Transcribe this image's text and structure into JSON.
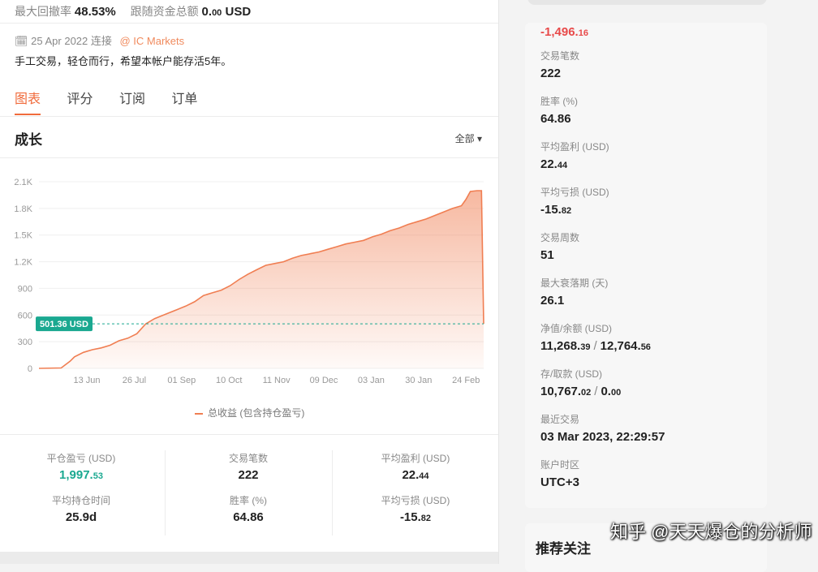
{
  "header": {
    "max_drawdown_label": "最大回撤率",
    "max_drawdown_value": "48.53%",
    "follow_funds_label": "跟随资金总额",
    "follow_funds_int": "0.",
    "follow_funds_dec": "00",
    "follow_funds_unit": "USD",
    "connect_date": "25 Apr 2022 连接",
    "broker": "@ IC Markets",
    "description": "手工交易，轻仓而行，希望本帐户能存活5年。"
  },
  "tabs": [
    {
      "label": "图表",
      "active": true
    },
    {
      "label": "评分",
      "active": false
    },
    {
      "label": "订阅",
      "active": false
    },
    {
      "label": "订单",
      "active": false
    }
  ],
  "growth": {
    "title": "成长",
    "range_label": "全部 ▾"
  },
  "chart_data": {
    "type": "area",
    "y_ticks": [
      "0",
      "300",
      "600",
      "900",
      "1.2K",
      "1.5K",
      "1.8K",
      "2.1K"
    ],
    "x_ticks": [
      "13 Jun",
      "26 Jul",
      "01 Sep",
      "10 Oct",
      "11 Nov",
      "09 Dec",
      "03 Jan",
      "30 Jan",
      "24 Feb"
    ],
    "ylim": [
      0,
      2100
    ],
    "series": [
      {
        "name": "总收益 (包含持仓盈亏)",
        "x": [
          0,
          0.05,
          0.07,
          0.08,
          0.1,
          0.12,
          0.14,
          0.16,
          0.18,
          0.2,
          0.22,
          0.24,
          0.26,
          0.27,
          0.29,
          0.31,
          0.33,
          0.35,
          0.37,
          0.39,
          0.41,
          0.43,
          0.45,
          0.47,
          0.49,
          0.51,
          0.53,
          0.55,
          0.57,
          0.59,
          0.61,
          0.63,
          0.65,
          0.67,
          0.69,
          0.71,
          0.73,
          0.75,
          0.77,
          0.79,
          0.81,
          0.83,
          0.85,
          0.87,
          0.89,
          0.91,
          0.93,
          0.95,
          0.96,
          0.97,
          0.985,
          0.995,
          1.0
        ],
        "values": [
          0,
          5,
          80,
          130,
          180,
          210,
          230,
          260,
          310,
          340,
          390,
          500,
          560,
          580,
          620,
          660,
          700,
          750,
          820,
          850,
          880,
          930,
          1000,
          1060,
          1110,
          1160,
          1180,
          1200,
          1240,
          1270,
          1290,
          1310,
          1340,
          1370,
          1400,
          1420,
          1440,
          1480,
          1510,
          1550,
          1580,
          1620,
          1650,
          1680,
          1720,
          1760,
          1800,
          1830,
          1900,
          1990,
          2000,
          2000,
          501.36
        ]
      }
    ],
    "current_value_label": "501.36 USD",
    "current_value": 501.36
  },
  "legend_label": "总收益 (包含持仓盈亏)",
  "stats": [
    {
      "label": "平仓盈亏 (USD)",
      "int": "1,997.",
      "dec": "53",
      "green": true
    },
    {
      "label": "交易笔数",
      "int": "222",
      "dec": "",
      "green": false
    },
    {
      "label": "平均盈利 (USD)",
      "int": "22.",
      "dec": "44",
      "green": false
    },
    {
      "label": "平均持仓时间",
      "int": "25.9d",
      "dec": "",
      "green": false
    },
    {
      "label": "胜率 (%)",
      "int": "64.86",
      "dec": "",
      "green": false
    },
    {
      "label": "平均亏损 (USD)",
      "int": "-15.",
      "dec": "82",
      "green": false
    }
  ],
  "sidebar": {
    "top_value_int": "-1,496.",
    "top_value_dec": "16",
    "items": [
      {
        "label": "交易笔数",
        "val": "222"
      },
      {
        "label": "胜率 (%)",
        "val": "64.86"
      },
      {
        "label": "平均盈利 (USD)",
        "val_int": "22.",
        "val_dec": "44"
      },
      {
        "label": "平均亏损 (USD)",
        "val_int": "-15.",
        "val_dec": "82"
      },
      {
        "label": "交易周数",
        "val": "51"
      },
      {
        "label": "最大衰落期 (天)",
        "val": "26.1"
      },
      {
        "label": "净值/余额 (USD)",
        "a_int": "11,268.",
        "a_dec": "39",
        "b_int": "12,764.",
        "b_dec": "56"
      },
      {
        "label": "存/取款 (USD)",
        "a_int": "10,767.",
        "a_dec": "02",
        "b_int": "0.",
        "b_dec": "00"
      },
      {
        "label": "最近交易",
        "val": "03 Mar 2023, 22:29:57"
      },
      {
        "label": "账户时区",
        "val": "UTC+3"
      }
    ],
    "slash": "/",
    "recommend_title": "推荐关注"
  },
  "watermark": "知乎 @天天爆仓的分析师"
}
